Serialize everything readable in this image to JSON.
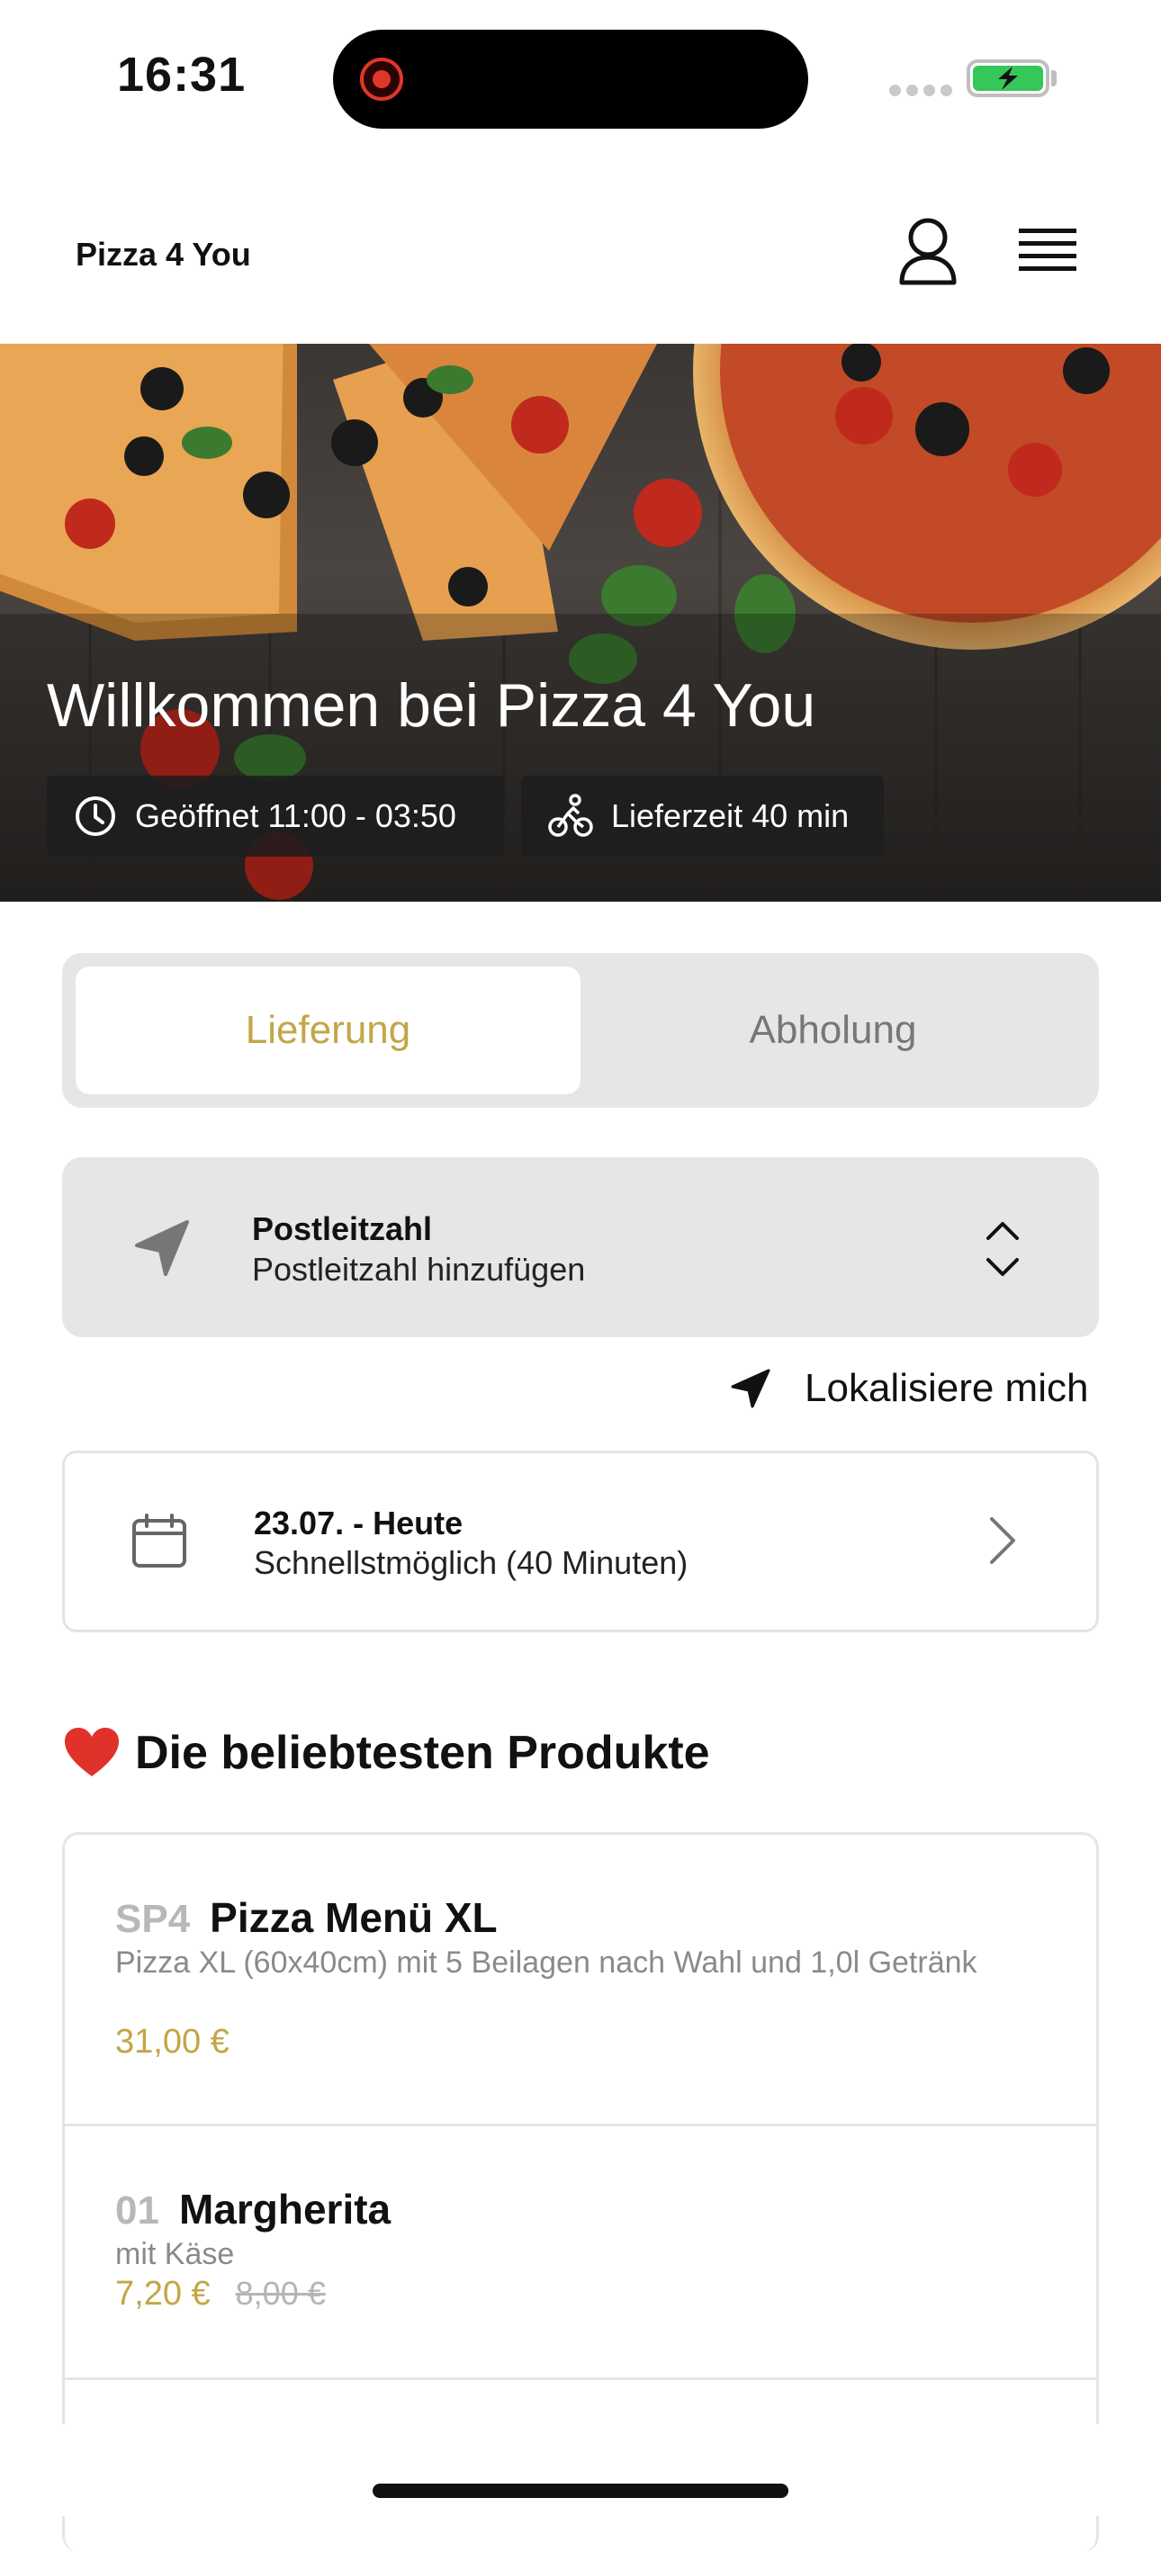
{
  "status_bar": {
    "time": "16:31"
  },
  "header": {
    "brand": "Pizza 4 You"
  },
  "hero": {
    "title": "Willkommen bei Pizza 4 You",
    "open_hours": "Geöffnet 11:00 - 03:50",
    "delivery_time": "Lieferzeit 40 min"
  },
  "order_mode": {
    "delivery_label": "Lieferung",
    "pickup_label": "Abholung",
    "selected": "Lieferung"
  },
  "postal": {
    "title": "Postleitzahl",
    "placeholder": "Postleitzahl hinzufügen"
  },
  "locate": {
    "label": "Lokalisiere mich"
  },
  "schedule": {
    "date": "23.07. - Heute",
    "time": "Schnellstmöglich (40 Minuten)"
  },
  "popular": {
    "title": "Die beliebtesten Produkte",
    "products": [
      {
        "code": "SP4",
        "name": "Pizza Menü XL",
        "desc": "Pizza XL (60x40cm) mit 5 Beilagen nach Wahl und 1,0l Getränk",
        "price": "31,00 €"
      },
      {
        "code": "01",
        "name": "Margherita",
        "desc": "mit Käse",
        "price": "7,20 €",
        "old_price": "8,00 €"
      }
    ]
  },
  "colors": {
    "accent": "#c3a646",
    "battery": "#35c759",
    "recording": "#e0362a"
  }
}
